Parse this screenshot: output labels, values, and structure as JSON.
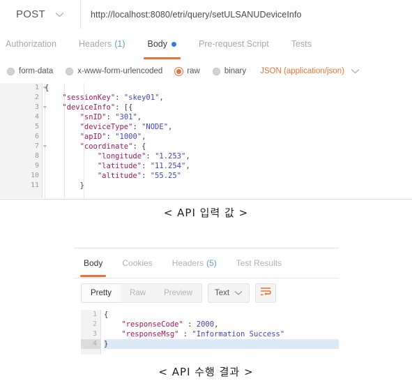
{
  "request": {
    "method": "POST",
    "url": "http://localhost:8080/etri/query/setULSANUDeviceInfo",
    "tabs": [
      {
        "label": "Authorization",
        "count": "",
        "active": false
      },
      {
        "label": "Headers",
        "count": "(1)",
        "active": false
      },
      {
        "label": "Body",
        "count": "",
        "active": true
      },
      {
        "label": "Pre-request Script",
        "count": "",
        "active": false
      },
      {
        "label": "Tests",
        "count": "",
        "active": false
      }
    ],
    "body_types": [
      {
        "label": "form-data",
        "selected": false
      },
      {
        "label": "x-www-form-urlencoded",
        "selected": false
      },
      {
        "label": "raw",
        "selected": true
      },
      {
        "label": "binary",
        "selected": false
      }
    ],
    "content_type": "JSON (application/json)",
    "editor": {
      "lines": [
        {
          "num": "1",
          "fold": true,
          "indent": 0,
          "tokens": [
            {
              "t": "p",
              "v": "{"
            }
          ]
        },
        {
          "num": "2",
          "fold": false,
          "indent": 1,
          "tokens": [
            {
              "t": "k",
              "v": "\"sessionKey\""
            },
            {
              "t": "p",
              "v": ": "
            },
            {
              "t": "s",
              "v": "\"skey01\""
            },
            {
              "t": "p",
              "v": ","
            }
          ]
        },
        {
          "num": "3",
          "fold": true,
          "indent": 1,
          "tokens": [
            {
              "t": "k",
              "v": "\"deviceInfo\""
            },
            {
              "t": "p",
              "v": ": [{"
            }
          ]
        },
        {
          "num": "4",
          "fold": false,
          "indent": 2,
          "tokens": [
            {
              "t": "k",
              "v": "\"snID\""
            },
            {
              "t": "p",
              "v": ": "
            },
            {
              "t": "s",
              "v": "\"301\""
            },
            {
              "t": "p",
              "v": ","
            }
          ]
        },
        {
          "num": "5",
          "fold": false,
          "indent": 2,
          "tokens": [
            {
              "t": "k",
              "v": "\"deviceType\""
            },
            {
              "t": "p",
              "v": ": "
            },
            {
              "t": "s",
              "v": "\"NODE\""
            },
            {
              "t": "p",
              "v": ","
            }
          ]
        },
        {
          "num": "6",
          "fold": false,
          "indent": 2,
          "tokens": [
            {
              "t": "k",
              "v": "\"apID\""
            },
            {
              "t": "p",
              "v": ": "
            },
            {
              "t": "s",
              "v": "\"1000\""
            },
            {
              "t": "p",
              "v": ","
            }
          ]
        },
        {
          "num": "7",
          "fold": true,
          "indent": 2,
          "tokens": [
            {
              "t": "k",
              "v": "\"coordinate\""
            },
            {
              "t": "p",
              "v": ": {"
            }
          ]
        },
        {
          "num": "8",
          "fold": false,
          "indent": 3,
          "tokens": [
            {
              "t": "k",
              "v": "\"longitude\""
            },
            {
              "t": "p",
              "v": ": "
            },
            {
              "t": "s",
              "v": "\"1.253\""
            },
            {
              "t": "p",
              "v": ","
            }
          ]
        },
        {
          "num": "9",
          "fold": false,
          "indent": 3,
          "tokens": [
            {
              "t": "k",
              "v": "\"latitude\""
            },
            {
              "t": "p",
              "v": ": "
            },
            {
              "t": "s",
              "v": "\"11.254\""
            },
            {
              "t": "p",
              "v": ","
            }
          ]
        },
        {
          "num": "10",
          "fold": false,
          "indent": 3,
          "tokens": [
            {
              "t": "k",
              "v": "\"altitude\""
            },
            {
              "t": "p",
              "v": ": "
            },
            {
              "t": "s",
              "v": "\"55.25\""
            }
          ]
        },
        {
          "num": "11",
          "fold": false,
          "indent": 2,
          "tokens": [
            {
              "t": "p",
              "v": "}"
            }
          ]
        }
      ]
    }
  },
  "caption_input": "< API 입력 값 >",
  "caption_result": "< API 수행 결과 >",
  "response": {
    "tabs": [
      {
        "label": "Body",
        "count": "",
        "active": true
      },
      {
        "label": "Cookies",
        "count": "",
        "active": false
      },
      {
        "label": "Headers",
        "count": "(5)",
        "active": false
      },
      {
        "label": "Test Results",
        "count": "",
        "active": false
      }
    ],
    "view_modes": [
      {
        "label": "Pretty",
        "active": true
      },
      {
        "label": "Raw",
        "active": false
      },
      {
        "label": "Preview",
        "active": false
      }
    ],
    "format": "Text",
    "wrap_icon": "word-wrap-icon",
    "editor": {
      "lines": [
        {
          "num": "1",
          "indent": 0,
          "highlight": false,
          "tokens": [
            {
              "t": "p",
              "v": "{"
            }
          ]
        },
        {
          "num": "2",
          "indent": 1,
          "highlight": false,
          "tokens": [
            {
              "t": "k",
              "v": "\"responseCode\""
            },
            {
              "t": "p",
              "v": " : "
            },
            {
              "t": "n",
              "v": "2000"
            },
            {
              "t": "p",
              "v": ","
            }
          ]
        },
        {
          "num": "3",
          "indent": 1,
          "highlight": false,
          "tokens": [
            {
              "t": "k",
              "v": "\"responseMsg\""
            },
            {
              "t": "p",
              "v": " : "
            },
            {
              "t": "s",
              "v": "\"Information Success\""
            }
          ]
        },
        {
          "num": "4",
          "indent": 0,
          "highlight": true,
          "tokens": [
            {
              "t": "p",
              "v": "}"
            }
          ]
        }
      ]
    }
  },
  "colors": {
    "accent_orange": "#e8733a",
    "link_blue": "#5b9bd5",
    "dot_blue": "#2f7ed8",
    "json_key": "#a3155f",
    "json_value": "#4242c7",
    "active_line": "#dce9f7"
  }
}
